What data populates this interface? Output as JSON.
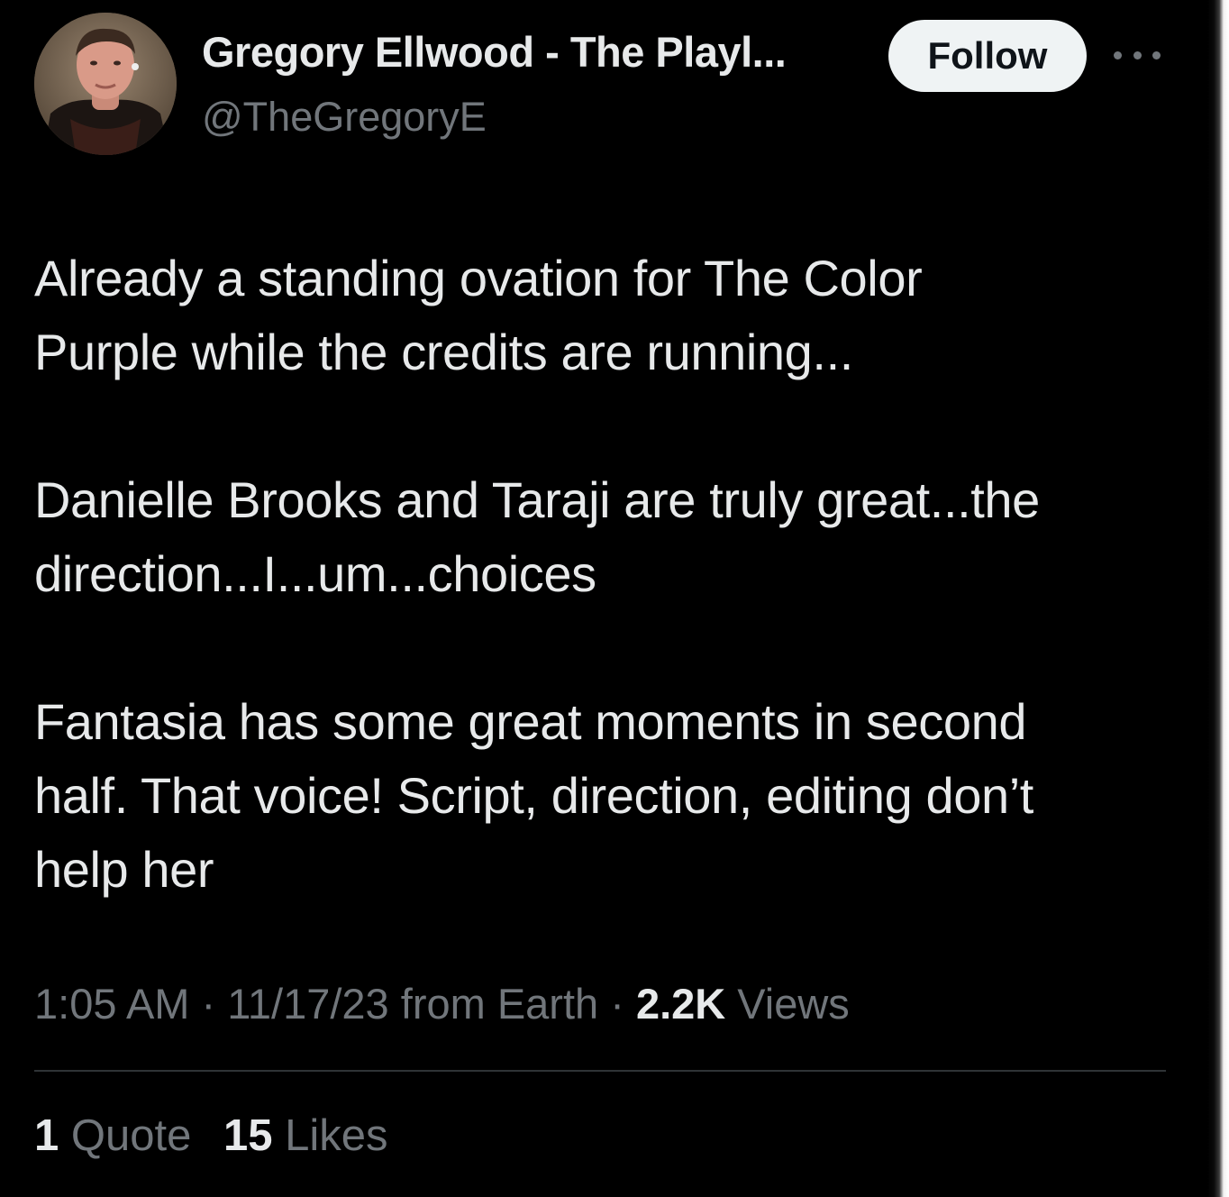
{
  "tweet": {
    "author": {
      "display_name": "Gregory Ellwood - The Playl...",
      "handle": "@TheGregoryE",
      "avatar_icon": "profile-photo"
    },
    "follow_label": "Follow",
    "more_icon": "more-horizontal-icon",
    "text": {
      "paragraph_1_line_1": "Already a standing ovation for The Color",
      "paragraph_1_line_2": "Purple while the credits are running...",
      "paragraph_2_line_1": "Danielle Brooks and Taraji are truly great...the",
      "paragraph_2_line_2": "direction...I...um...choices",
      "paragraph_3_line_1": "Fantasia has some great moments in second",
      "paragraph_3_line_2": "half. That voice! Script, direction, editing don’t",
      "paragraph_3_line_3": "help her"
    },
    "meta": {
      "time": "1:05 AM",
      "separator": " · ",
      "date": "11/17/23",
      "source": " from Earth",
      "views_count": "2.2K",
      "views_label": " Views"
    },
    "stats": {
      "quotes_count": "1",
      "quotes_label": " Quote",
      "likes_count": "15",
      "likes_label": " Likes"
    }
  },
  "colors": {
    "background": "#000000",
    "primary_text": "#e7e9ea",
    "secondary_text": "#71767b",
    "follow_button_bg": "#eff3f4",
    "divider": "#2f3336"
  }
}
